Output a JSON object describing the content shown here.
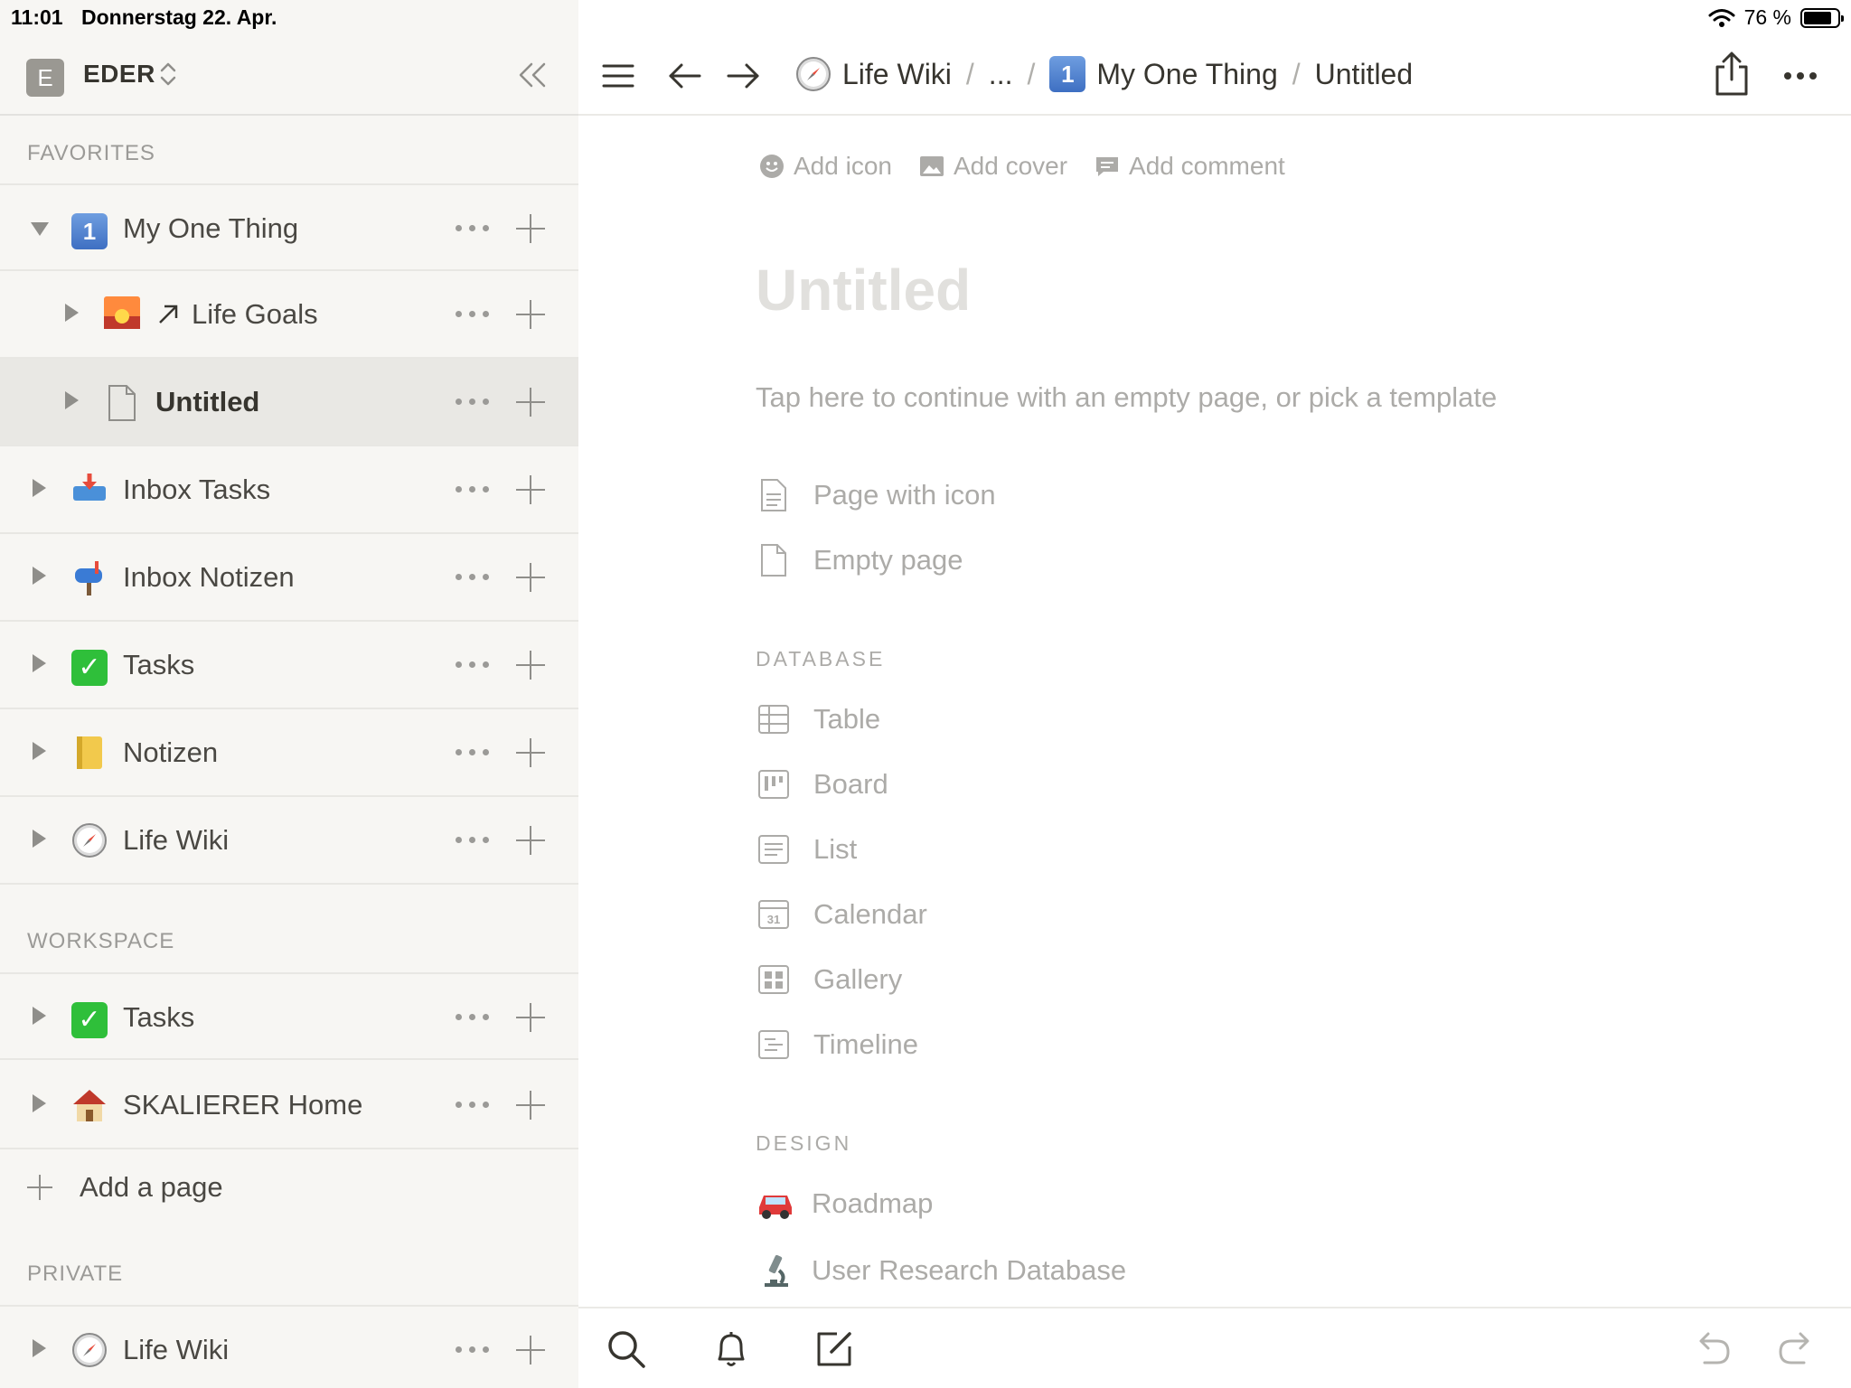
{
  "status_bar": {
    "time": "11:01",
    "date": "Donnerstag 22. Apr.",
    "battery": "76 %"
  },
  "workspace": {
    "initial": "E",
    "name": "EDER"
  },
  "sidebar": {
    "favorites_label": "FAVORITES",
    "workspace_label": "WORKSPACE",
    "private_label": "PRIVATE",
    "favorites": [
      {
        "label": "My One Thing"
      },
      {
        "label": "Life Goals"
      },
      {
        "label": "Untitled"
      },
      {
        "label": "Inbox Tasks"
      },
      {
        "label": "Inbox Notizen"
      },
      {
        "label": "Tasks"
      },
      {
        "label": "Notizen"
      },
      {
        "label": "Life Wiki"
      }
    ],
    "workspace_items": [
      {
        "label": "Tasks"
      },
      {
        "label": "SKALIERER Home"
      }
    ],
    "add_page": "Add a page",
    "private_items": [
      {
        "label": "Life Wiki"
      }
    ]
  },
  "breadcrumb": {
    "items": [
      "Life Wiki",
      "...",
      "My One Thing",
      "Untitled"
    ],
    "separator": "/"
  },
  "page": {
    "actions": {
      "add_icon": "Add icon",
      "add_cover": "Add cover",
      "add_comment": "Add comment"
    },
    "title_placeholder": "Untitled",
    "hint": "Tap here to continue with an empty page, or pick a template",
    "basic_templates": [
      {
        "label": "Page with icon"
      },
      {
        "label": "Empty page"
      }
    ],
    "database_label": "DATABASE",
    "database_templates": [
      {
        "label": "Table"
      },
      {
        "label": "Board"
      },
      {
        "label": "List"
      },
      {
        "label": "Calendar"
      },
      {
        "label": "Gallery"
      },
      {
        "label": "Timeline"
      }
    ],
    "design_label": "DESIGN",
    "design_templates": [
      {
        "label": "Roadmap"
      },
      {
        "label": "User Research Database"
      }
    ]
  },
  "icons": {
    "number_badge": "1",
    "calendar_day": "31"
  },
  "colors": {
    "sidebar_bg": "#f7f6f3",
    "selected_row": "#e9e8e4",
    "muted_text": "#acaba8",
    "title_placeholder": "#e1e0dd"
  }
}
